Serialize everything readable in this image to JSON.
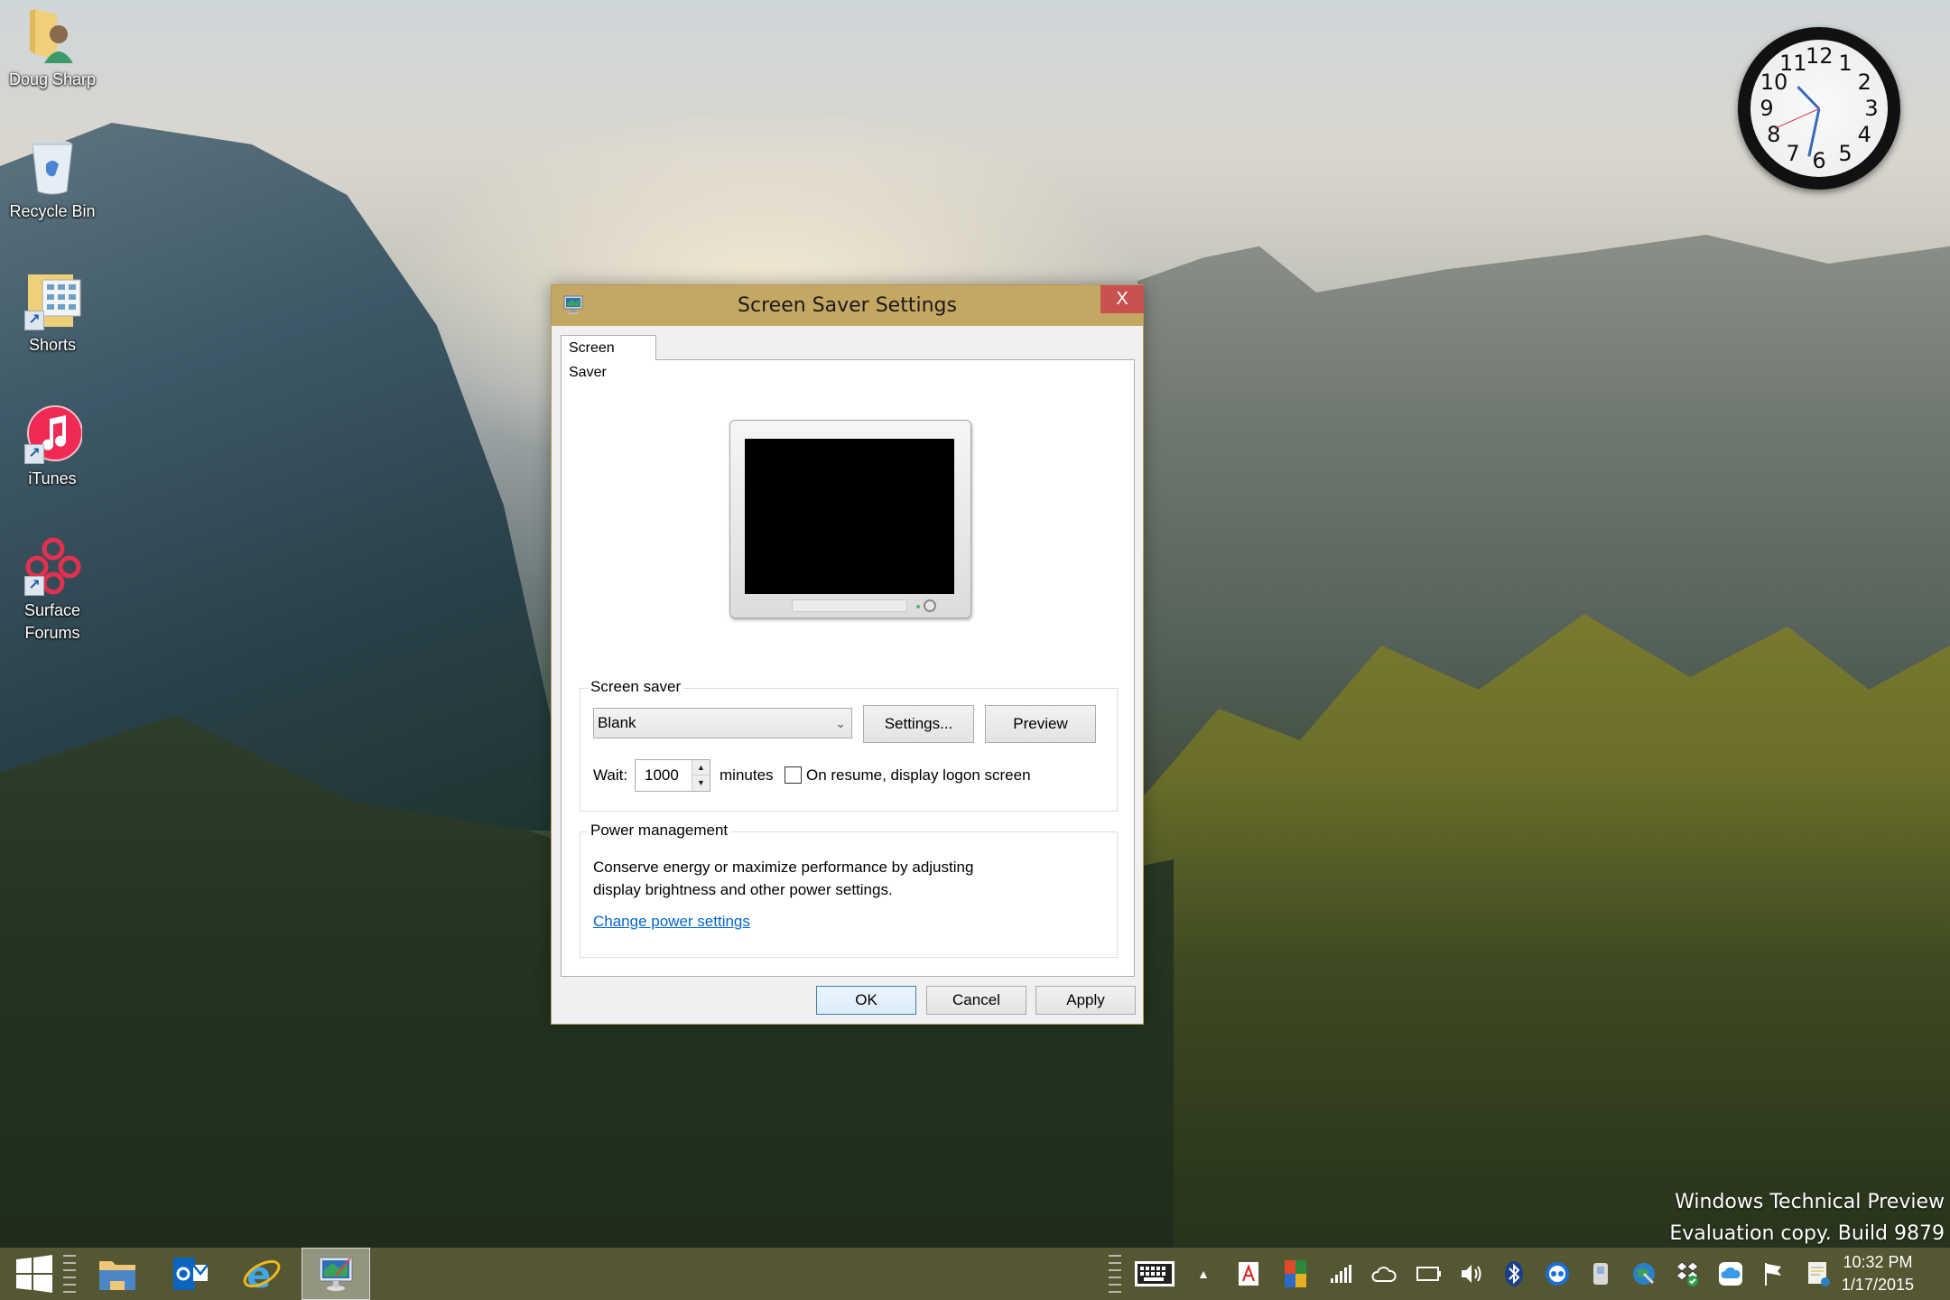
{
  "desktop": {
    "icons": [
      {
        "label": "Doug Sharp",
        "icon": "user-folder-icon"
      },
      {
        "label": "Recycle Bin",
        "icon": "recycle-bin-icon"
      },
      {
        "label": "Shorts",
        "icon": "folder-shortcut-icon"
      },
      {
        "label": "iTunes",
        "icon": "itunes-icon"
      },
      {
        "label": "Surface Forums",
        "icon": "surface-forums-icon"
      }
    ],
    "clock": {
      "numbers": [
        "12",
        "1",
        "2",
        "3",
        "4",
        "5",
        "6",
        "7",
        "8",
        "9",
        "10",
        "11"
      ],
      "hour": 10,
      "minute": 32,
      "second": 41
    },
    "watermark": {
      "line1": "Windows Technical Preview",
      "line2": "Evaluation copy. Build 9879"
    }
  },
  "dialog": {
    "title": "Screen Saver Settings",
    "close_label": "X",
    "tab": "Screen Saver",
    "screen_saver_group": {
      "label": "Screen saver",
      "selected": "Blank",
      "settings_button": "Settings...",
      "preview_button": "Preview",
      "wait_label": "Wait:",
      "wait_value": "1000",
      "minutes_label": "minutes",
      "logon_checkbox_label": "On resume, display logon screen",
      "logon_checked": false
    },
    "power_group": {
      "label": "Power management",
      "description_line1": "Conserve energy or maximize performance by adjusting",
      "description_line2": "display brightness and other power settings.",
      "link": "Change power settings"
    },
    "buttons": {
      "ok": "OK",
      "cancel": "Cancel",
      "apply": "Apply"
    }
  },
  "taskbar": {
    "pinned": [
      {
        "name": "start-button",
        "icon": "windows-logo-icon"
      },
      {
        "name": "file-explorer",
        "icon": "file-explorer-icon"
      },
      {
        "name": "outlook",
        "icon": "outlook-icon"
      },
      {
        "name": "internet-explorer",
        "icon": "internet-explorer-icon"
      },
      {
        "name": "screen-saver-settings",
        "icon": "display-settings-icon",
        "active": true
      }
    ],
    "tray": [
      "touch-keyboard-icon",
      "show-hidden-icons-icon",
      "pdf-icon",
      "office-icon",
      "signal-icon",
      "onedrive-icon",
      "battery-icon",
      "volume-icon",
      "bluetooth-icon",
      "app-blue-icon",
      "usb-drive-icon",
      "network-globe-icon",
      "dropbox-icon",
      "icloud-icon",
      "action-center-flag-icon",
      "notification-icon"
    ],
    "time": "10:32 PM",
    "date": "1/17/2015"
  },
  "colors": {
    "titlebar": "#c4a763",
    "close": "#c7514f",
    "link": "#0066cc",
    "taskbar": "#606038"
  }
}
